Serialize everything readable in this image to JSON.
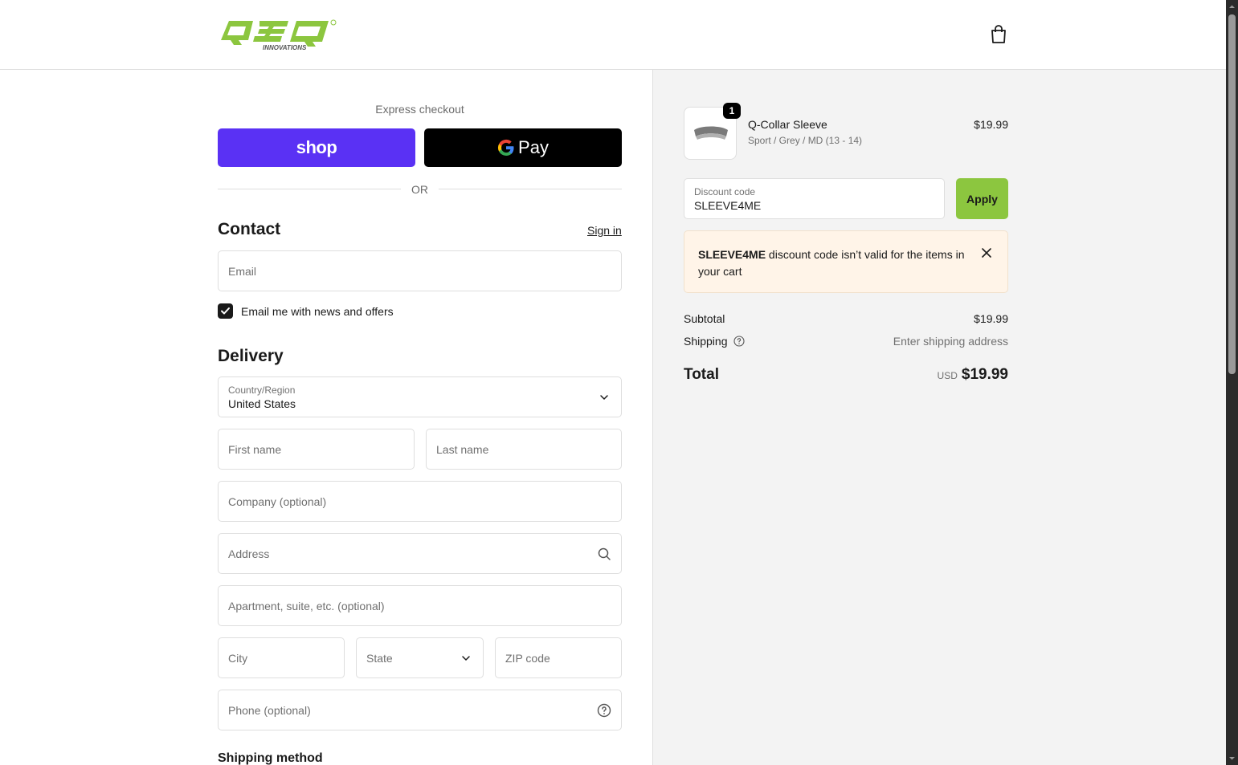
{
  "brand": {
    "logo_text": "Q3Q",
    "logo_sub": "INNOVATIONS",
    "accent_color": "#8cc63f"
  },
  "icons": {
    "cart": "shopping-bag-icon",
    "dropdown": "chevron-down-icon",
    "search": "search-icon",
    "help": "question-circle-icon",
    "close": "close-icon",
    "check": "checkmark-icon"
  },
  "express": {
    "label": "Express checkout",
    "shop_label": "shop",
    "gpay_label": "Pay",
    "or_label": "OR"
  },
  "contact": {
    "title": "Contact",
    "signin_label": "Sign in",
    "email_placeholder": "Email",
    "newsletter_label": "Email me with news and offers",
    "newsletter_checked": true
  },
  "delivery": {
    "title": "Delivery",
    "country_label": "Country/Region",
    "country_value": "United States",
    "first_name_placeholder": "First name",
    "last_name_placeholder": "Last name",
    "company_placeholder": "Company (optional)",
    "address_placeholder": "Address",
    "apartment_placeholder": "Apartment, suite, etc. (optional)",
    "city_placeholder": "City",
    "state_placeholder": "State",
    "zip_placeholder": "ZIP code",
    "phone_placeholder": "Phone (optional)"
  },
  "shipping_method": {
    "title": "Shipping method"
  },
  "cart": {
    "items": [
      {
        "quantity": "1",
        "name": "Q-Collar Sleeve",
        "variant": "Sport / Grey / MD (13 - 14)",
        "price": "$19.99"
      }
    ]
  },
  "discount": {
    "label": "Discount code",
    "value": "SLEEVE4ME",
    "apply_label": "Apply",
    "error_code": "SLEEVE4ME",
    "error_message": " discount code isn’t valid for the items in your cart"
  },
  "summary": {
    "subtotal_label": "Subtotal",
    "subtotal_value": "$19.99",
    "shipping_label": "Shipping",
    "shipping_value": "Enter shipping address",
    "total_label": "Total",
    "currency": "USD",
    "total_value": "$19.99"
  }
}
